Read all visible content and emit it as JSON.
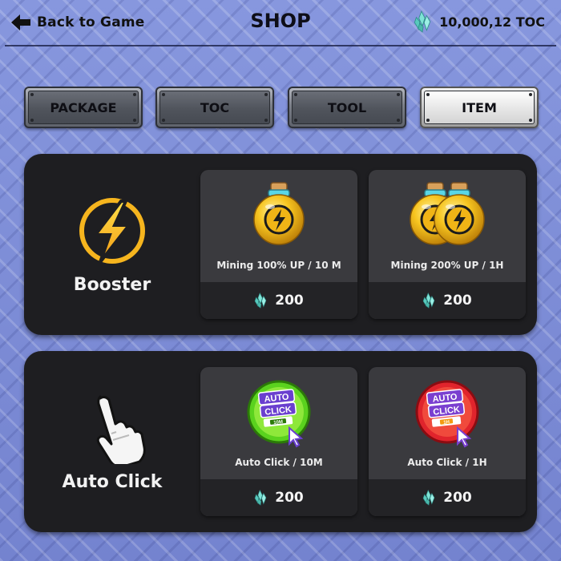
{
  "header": {
    "back_label": "Back to Game",
    "title": "SHOP",
    "balance": "10,000,12",
    "currency": "TOC",
    "currency_icon": "crystal-icon"
  },
  "tabs": [
    {
      "label": "PACKAGE",
      "active": false
    },
    {
      "label": "TOC",
      "active": false
    },
    {
      "label": "TOOL",
      "active": false
    },
    {
      "label": "ITEM",
      "active": true
    }
  ],
  "sections": [
    {
      "category": "Booster",
      "icon": "lightning-icon",
      "items": [
        {
          "name": "Mining 100% UP / 10 M",
          "price": "200",
          "icon": "booster-potion-icon"
        },
        {
          "name": "Mining 200% UP / 1H",
          "price": "200",
          "icon": "double-booster-potion-icon"
        }
      ]
    },
    {
      "category": "Auto Click",
      "icon": "pointer-hand-icon",
      "items": [
        {
          "name": "Auto Click / 10M",
          "price": "200",
          "icon": "auto-click-green-badge-icon",
          "badge_text": [
            "AUTO",
            "CLICK",
            "10M"
          ]
        },
        {
          "name": "Auto Click / 1H",
          "price": "200",
          "icon": "auto-click-red-badge-icon",
          "badge_text": [
            "AUTO",
            "CLICK",
            "1H"
          ]
        }
      ]
    }
  ],
  "colors": {
    "background": "#7f8ed8",
    "panel": "#1e1e21",
    "card": "#3a3a3e",
    "accent_gold": "#f6b51e",
    "crystal": "#63d6c7"
  }
}
